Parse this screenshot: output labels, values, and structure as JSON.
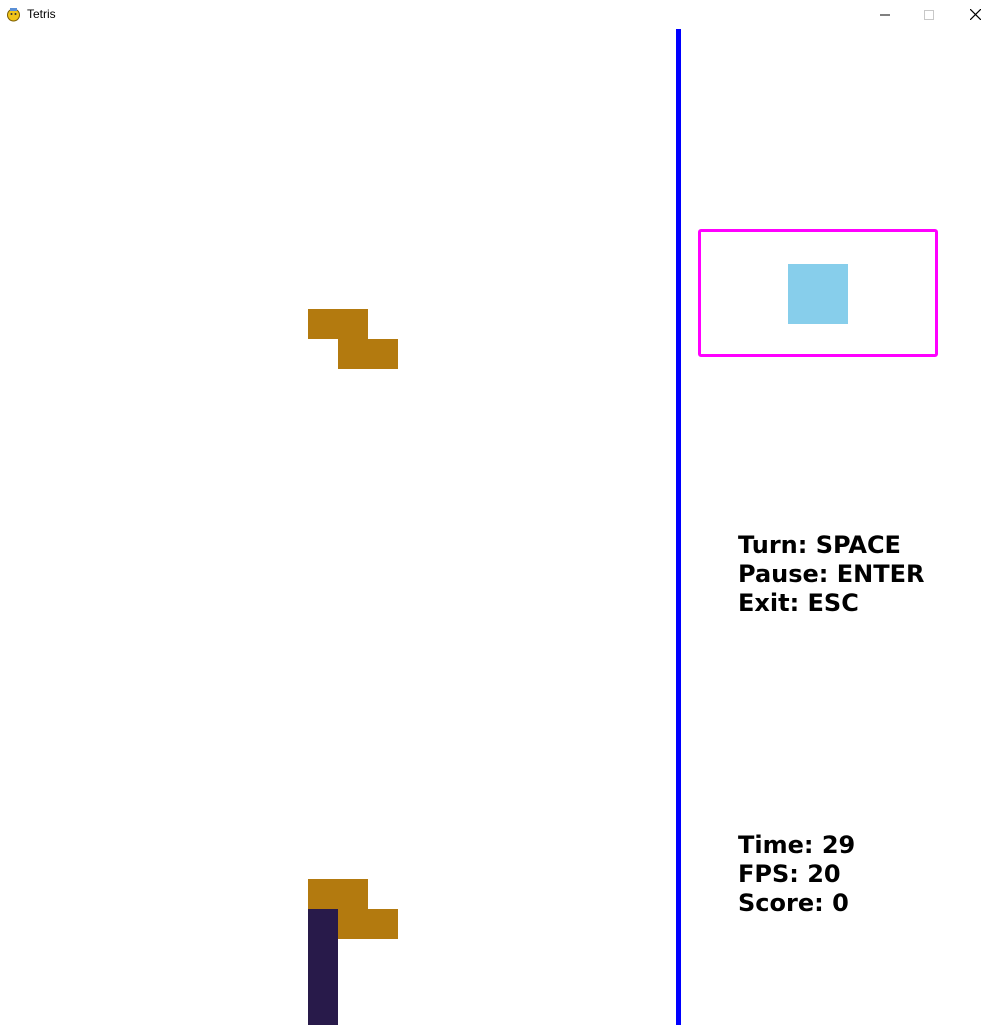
{
  "window": {
    "title": "Tetris"
  },
  "colors": {
    "divider": "#0000ff",
    "preview_border": "#ff00ff",
    "z_piece": "#b37a0f",
    "i_piece": "#281a4a",
    "o_piece": "#87ceeb"
  },
  "controls": {
    "turn": "Turn: SPACE",
    "pause": "Pause: ENTER",
    "exit": "Exit: ESC"
  },
  "stats": {
    "time": "Time: 29",
    "fps": "FPS: 20",
    "score": "Score: 0"
  }
}
